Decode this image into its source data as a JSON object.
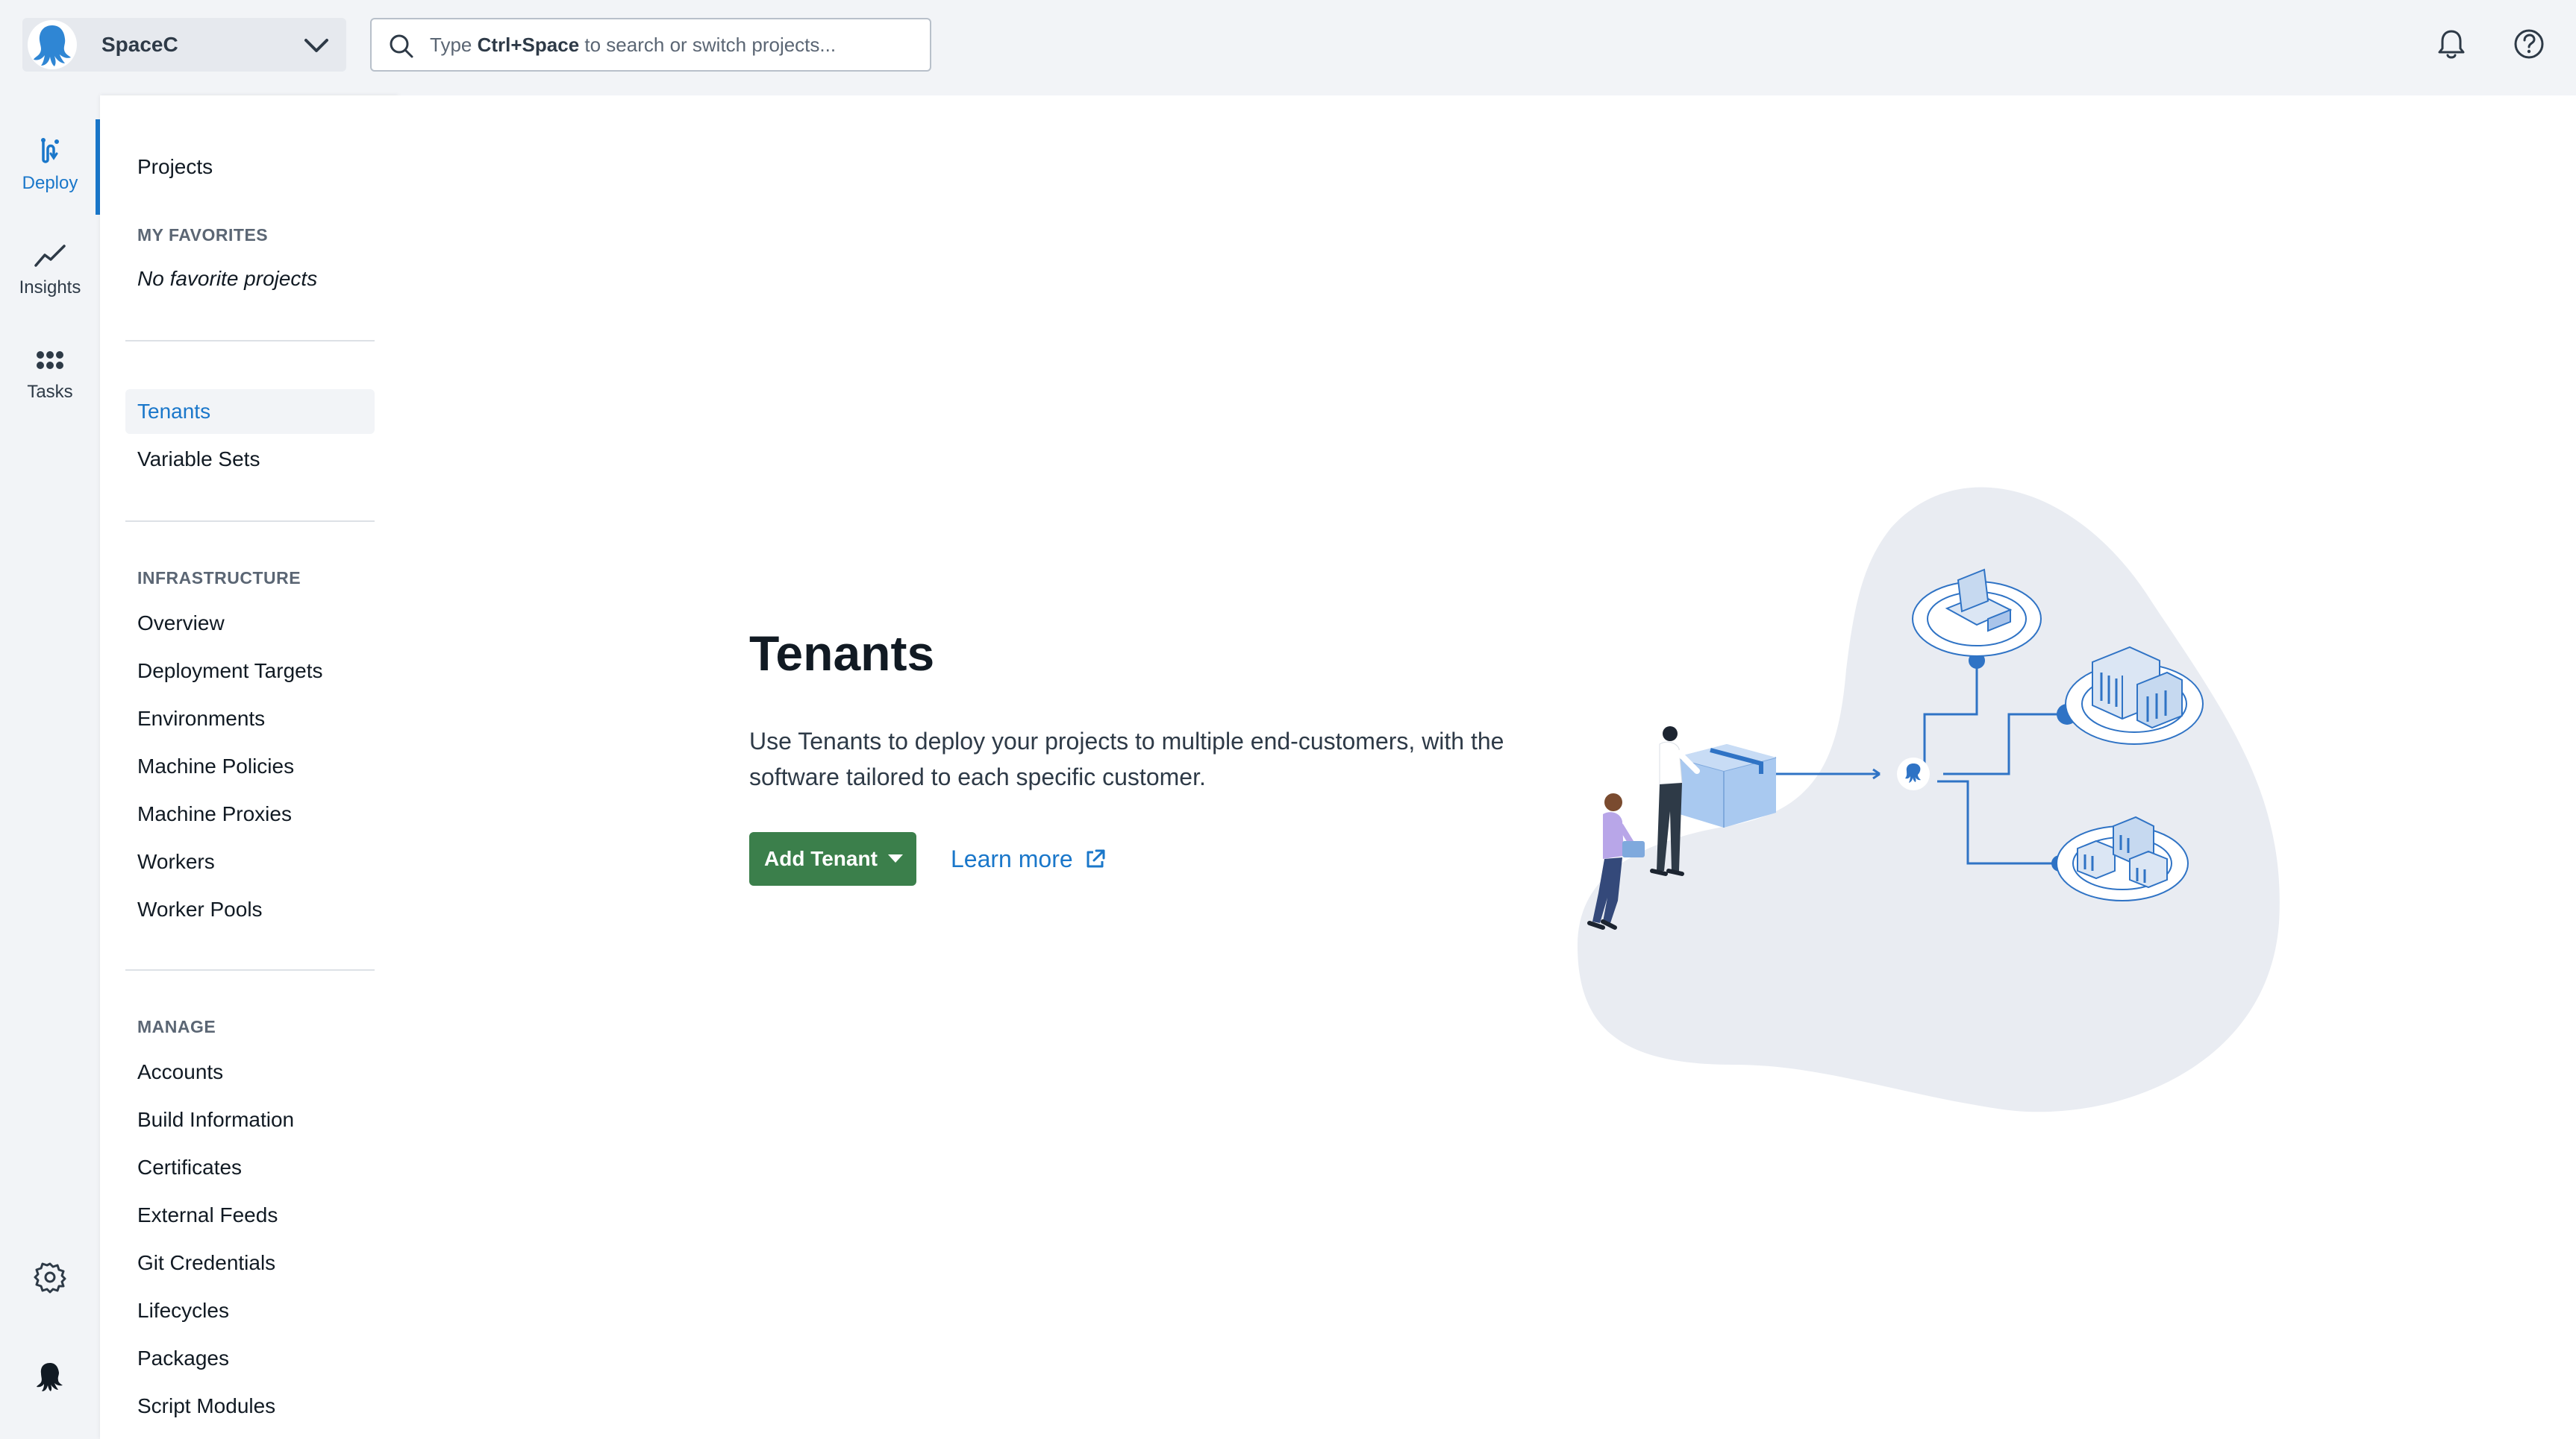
{
  "topbar": {
    "space_name": "SpaceC",
    "search_prefix": "Type ",
    "search_shortcut": "Ctrl+Space",
    "search_suffix": " to search or switch projects..."
  },
  "rail": {
    "items": [
      {
        "label": "Deploy",
        "icon": "deploy-icon",
        "active": true
      },
      {
        "label": "Insights",
        "icon": "insights-icon",
        "active": false
      },
      {
        "label": "Tasks",
        "icon": "tasks-icon",
        "active": false
      }
    ]
  },
  "sidenav": {
    "projects": "Projects",
    "favorites_heading": "MY FAVORITES",
    "no_favorites": "No favorite projects",
    "tenants": "Tenants",
    "variable_sets": "Variable Sets",
    "infrastructure_heading": "INFRASTRUCTURE",
    "infrastructure": [
      "Overview",
      "Deployment Targets",
      "Environments",
      "Machine Policies",
      "Machine Proxies",
      "Workers",
      "Worker Pools"
    ],
    "manage_heading": "MANAGE",
    "manage": [
      "Accounts",
      "Build Information",
      "Certificates",
      "External Feeds",
      "Git Credentials",
      "Lifecycles",
      "Packages",
      "Script Modules"
    ]
  },
  "main": {
    "title": "Tenants",
    "description": "Use Tenants to deploy your projects to multiple end-customers, with the software tailored to each specific customer.",
    "add_button": "Add Tenant",
    "learn_more": "Learn more"
  },
  "colors": {
    "accent": "#1a77ca",
    "primary_button": "#3b7f4b",
    "background": "#f2f4f7"
  }
}
